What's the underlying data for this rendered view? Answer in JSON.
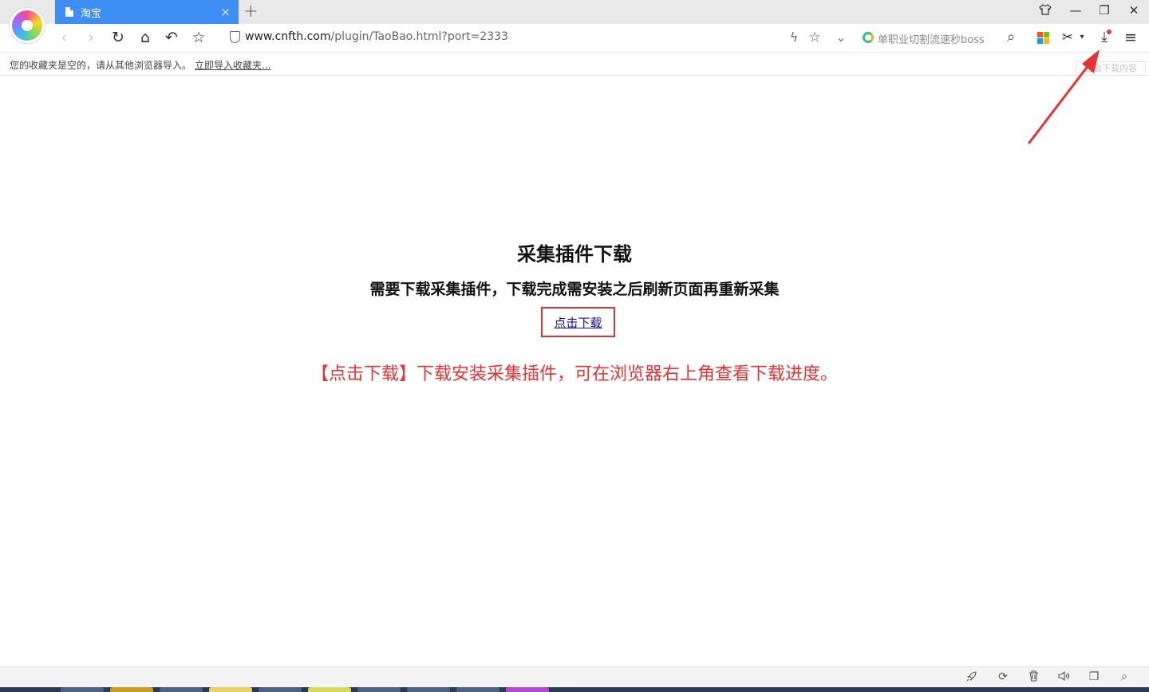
{
  "browser": {
    "tab_title": "淘宝",
    "tab_close": "×",
    "new_tab": "+",
    "window_controls": {
      "skin": "skin-icon",
      "minimize": "—",
      "restore": "❐",
      "close": "✕"
    },
    "nav": {
      "back": "‹",
      "forward": "›",
      "reload": "↻",
      "home": "⌂",
      "undo": "↶",
      "favorite": "☆"
    },
    "address": {
      "host": "www.cnfth.com",
      "path": "/plugin/TaoBao.html?port=2333"
    },
    "toolbar_icons": {
      "lightning": "ϟ",
      "star": "☆",
      "dropdown": "⌄",
      "search": "⌕",
      "scissors": "✂",
      "scissors_menu": "▾",
      "download": "⤓",
      "menu": "≡"
    },
    "search_hint": "单职业切割流速秒boss",
    "ms_colors": [
      "#f35325",
      "#81bc06",
      "#05a6f0",
      "#ffba08"
    ]
  },
  "bookmarks": {
    "empty_text": "您的收藏夹是空的，请从其他浏览器导入。",
    "import_link": "立即导入收藏夹...",
    "view_content": "查看下载内容"
  },
  "page": {
    "title": "采集插件下载",
    "subtitle": "需要下载采集插件，下载完成需安装之后刷新页面再重新采集",
    "download_link": "点击下载",
    "instruction": "【点击下载】下载安装采集插件，可在浏览器右上角查看下载进度。"
  },
  "statusbar": {
    "rocket": "🚀",
    "speed": "⟳",
    "trash": "🗑",
    "sound": "🔈",
    "window": "❐",
    "zoom": "⌕"
  },
  "colors": {
    "tab_active": "#3d8ef5",
    "annotation_red": "#e53333",
    "link_blue": "#1a0dab"
  }
}
